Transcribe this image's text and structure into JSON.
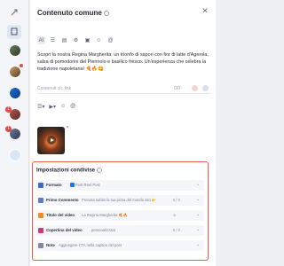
{
  "header": {
    "title": "Contenuto comune",
    "close_icon": "close-icon"
  },
  "editor": {
    "toolbar": [
      "AI",
      "text",
      "format",
      "settings",
      "image",
      "emoji",
      "mention"
    ],
    "text": "Scopri la nostra Regina Margherita: un trionfo di sapori con fior di latte d'Agerola, salsa di pomodorini del Piennolo e basilico fresco. Un'esperienza che celebra la tradizione napoletana! 🍕🔥😋",
    "cta_placeholder": "Contenuti cit. link",
    "cta_count": "0/0"
  },
  "shared": {
    "title": "Impostazioni condivise",
    "rows": [
      {
        "label": "Formato",
        "value": "Post  Reel  Post"
      },
      {
        "label": "Primo Commento",
        "value": "Prenota subito la tua pizza del mondo sito 👉",
        "info": "0 / 0"
      },
      {
        "label": "Titolo del video",
        "value": "La Regina Margherita 🍕🔥",
        "info": "⊘"
      },
      {
        "label": "Copertina del video",
        "value": "personalizzata",
        "info": "0 / 0"
      },
      {
        "label": "Note",
        "value": "Aggiungere CTA nella caption del post"
      }
    ]
  },
  "colors": {
    "accent_red": "#e3624f",
    "instagram": "#d6367a",
    "facebook": "#1877f2",
    "tiktok": "#111111"
  }
}
